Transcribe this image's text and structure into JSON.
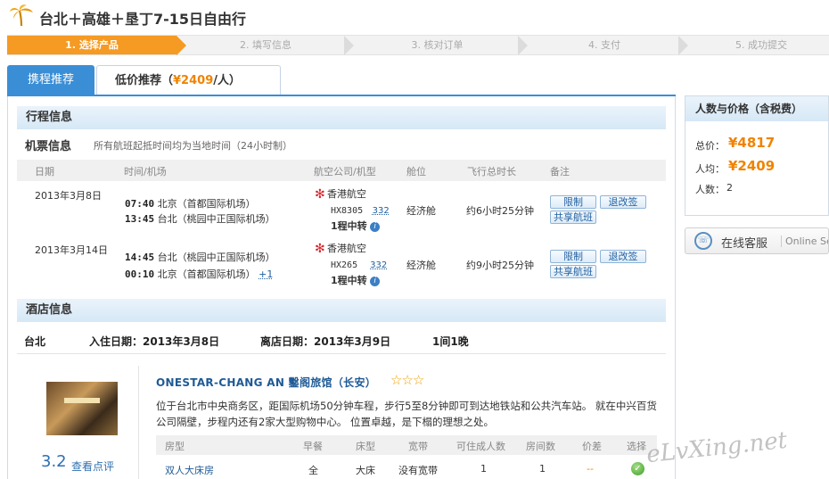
{
  "header": {
    "title": "台北＋高雄＋垦丁7-15日自由行",
    "logo_icon": "palm-tree-icon"
  },
  "steps": [
    {
      "label": "1. 选择产品",
      "active": true
    },
    {
      "label": "2. 填写信息",
      "active": false
    },
    {
      "label": "3. 核对订单",
      "active": false
    },
    {
      "label": "4. 支付",
      "active": false
    },
    {
      "label": "5. 成功提交",
      "active": false
    }
  ],
  "tabs": {
    "ctrip": "携程推荐",
    "low_prefix": "低价推荐（",
    "low_price": "¥2409",
    "low_suffix": "/人）"
  },
  "itinerary": {
    "title": "行程信息",
    "flight_title": "机票信息",
    "flight_note": "所有航班起抵时间均为当地时间（24小时制）",
    "columns": [
      "日期",
      "时间/机场",
      "航空公司/机型",
      "舱位",
      "飞行总时长",
      "备注"
    ],
    "flights": [
      {
        "date": "2013年3月8日",
        "dep_time": "07:40",
        "dep_airport": "北京（首都国际机场）",
        "arr_time": "13:45",
        "arr_airport": "台北（桃园中正国际机场）",
        "arr_plus": "",
        "airline": "香港航空",
        "flight_no": "HX8305",
        "plane": "332",
        "transfer": "1程中转",
        "cabin": "经济舱",
        "duration": "约6小时25分钟",
        "btn_limit": "限制",
        "btn_refund": "退改签",
        "btn_share": "共享航班"
      },
      {
        "date": "2013年3月14日",
        "dep_time": "14:45",
        "dep_airport": "台北（桃园中正国际机场）",
        "arr_time": "00:10",
        "arr_airport": "北京（首都国际机场）",
        "arr_plus": "+1",
        "airline": "香港航空",
        "flight_no": "HX265",
        "plane": "332",
        "transfer": "1程中转",
        "cabin": "经济舱",
        "duration": "约9小时25分钟",
        "btn_limit": "限制",
        "btn_refund": "退改签",
        "btn_share": "共享航班"
      }
    ]
  },
  "hotel": {
    "section_title": "酒店信息",
    "city": "台北",
    "checkin": "入住日期：2013年3月8日",
    "checkout": "离店日期：2013年3月9日",
    "nights": "1间1晚",
    "name": "ONESTAR-CHANG AN 鑿阁旅馆（长安）",
    "stars": "☆☆☆",
    "description": "位于台北市中央商务区，距国际机场50分钟车程，步行5至8分钟即可到达地铁站和公共汽车站。 就在中兴百货公司隔壁，步程内还有2家大型购物中心。 位置卓越，是下榻的理想之处。",
    "score": "3.2",
    "review_link": "查看点评",
    "room_columns": [
      "房型",
      "早餐",
      "床型",
      "宽带",
      "可住成人数",
      "房间数",
      "价差",
      "选择"
    ],
    "rooms": [
      {
        "type": "双人大床房",
        "breakfast": "全",
        "bed": "大床",
        "broadband": "没有宽带",
        "adults": "1",
        "count": "1",
        "price_diff": "--"
      }
    ]
  },
  "price_panel": {
    "title": "人数与价格（含税费）",
    "total_label": "总价：",
    "total_value": "¥4817",
    "per_label": "人均：",
    "per_value": "¥2409",
    "count_label": "人数：",
    "count_value": "2"
  },
  "service": {
    "label": "在线客服",
    "sub": "Online Serv"
  },
  "watermark": "eLvXing.net",
  "colors": {
    "accent_orange": "#f08300",
    "tab_blue": "#3a8ed6",
    "link_blue": "#1f5a96"
  }
}
